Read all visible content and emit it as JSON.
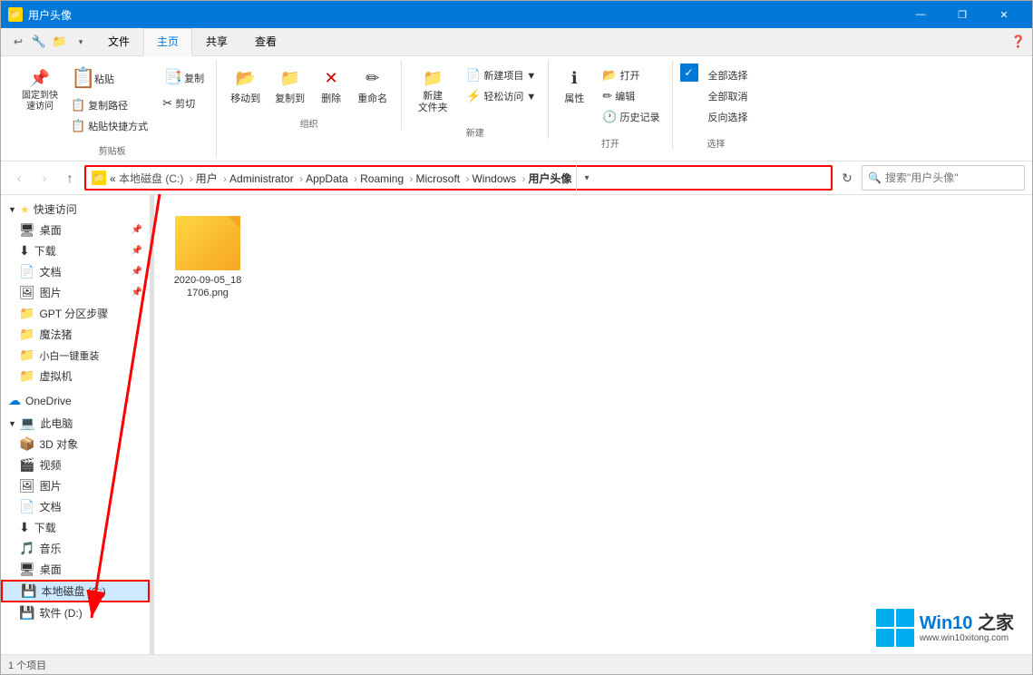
{
  "titleBar": {
    "title": "用户头像",
    "minimizeLabel": "—",
    "restoreLabel": "❐",
    "closeLabel": "✕"
  },
  "ribbon": {
    "tabs": [
      {
        "label": "文件",
        "active": false
      },
      {
        "label": "主页",
        "active": true
      },
      {
        "label": "共享",
        "active": false
      },
      {
        "label": "查看",
        "active": false
      }
    ],
    "groups": {
      "clipboard": {
        "label": "剪贴板",
        "pinBtn": "固定到快\n速访问",
        "copyBtn": "复制",
        "pasteBtn": "粘贴",
        "cutBtn": "✂ 剪切",
        "copyPathBtn": "复制路径",
        "pasteShortcutBtn": "粘贴快捷方式"
      },
      "organize": {
        "label": "组织",
        "moveToBtn": "移动到",
        "copyToBtn": "复制到",
        "deleteBtn": "删除",
        "renameBtn": "重命名"
      },
      "new": {
        "label": "新建",
        "newFolderBtn": "新建\n文件夹",
        "newItemBtn": "新建项目▼",
        "easyAccessBtn": "轻松访问▼"
      },
      "open": {
        "label": "打开",
        "propertiesBtn": "属性",
        "openBtn": "打开",
        "editBtn": "编辑",
        "historyBtn": "历史记录"
      },
      "select": {
        "label": "选择",
        "selectAllBtn": "全部选择",
        "selectNoneBtn": "全部取消",
        "invertBtn": "反向选择"
      }
    }
  },
  "quickAccess": {
    "undoLabel": "↩",
    "propertiesLabel": "🔧",
    "newFolderLabel": "📁",
    "dropdownLabel": "▾"
  },
  "navBar": {
    "backLabel": "‹",
    "forwardLabel": "›",
    "upLabel": "↑",
    "path": "本地磁盘 (C:) › 用户 › Administrator › AppData › Roaming › Microsoft › Windows › 用户头像",
    "pathShort": "« 本地磁盘 (C:) > 用户 > Administrator > AppData > Roaming > Microsoft > Windows > 用户头像",
    "dropdownLabel": "▾",
    "refreshLabel": "↻",
    "searchPlaceholder": "搜索\"用户头像\""
  },
  "sidebar": {
    "quickAccessLabel": "快速访问",
    "items": [
      {
        "label": "桌面",
        "icon": "🖥",
        "pin": true
      },
      {
        "label": "下载",
        "icon": "⬇",
        "pin": true
      },
      {
        "label": "文档",
        "icon": "📄",
        "pin": true
      },
      {
        "label": "图片",
        "icon": "🖼",
        "pin": true
      },
      {
        "label": "GPT 分区步骤",
        "icon": "📁",
        "pin": false
      },
      {
        "label": "魔法猪",
        "icon": "📁",
        "pin": false
      },
      {
        "label": "小白一键重装",
        "icon": "📁",
        "pin": false
      },
      {
        "label": "虚拟机",
        "icon": "📁",
        "pin": false
      }
    ],
    "oneDriveLabel": "OneDrive",
    "thisPcLabel": "此电脑",
    "thisPcItems": [
      {
        "label": "3D 对象",
        "icon": "📦"
      },
      {
        "label": "视频",
        "icon": "🎬"
      },
      {
        "label": "图片",
        "icon": "🖼"
      },
      {
        "label": "文档",
        "icon": "📄"
      },
      {
        "label": "下载",
        "icon": "⬇"
      },
      {
        "label": "音乐",
        "icon": "🎵"
      },
      {
        "label": "桌面",
        "icon": "🖥"
      },
      {
        "label": "本地磁盘 (C:)",
        "icon": "💾",
        "selected": true
      },
      {
        "label": "软件 (D:)",
        "icon": "💾"
      }
    ]
  },
  "content": {
    "file": {
      "name": "2020-09-05_181706.png",
      "iconColor": "#ffd740"
    }
  },
  "statusBar": {
    "text": "1 个项目"
  },
  "watermark": {
    "brand": "Win10",
    "brandSuffix": "之家",
    "url": "www.win10xitong.com"
  },
  "annotations": {
    "redBorderAddress": true,
    "redBorderLocalDisk": true,
    "arrowVisible": true
  }
}
